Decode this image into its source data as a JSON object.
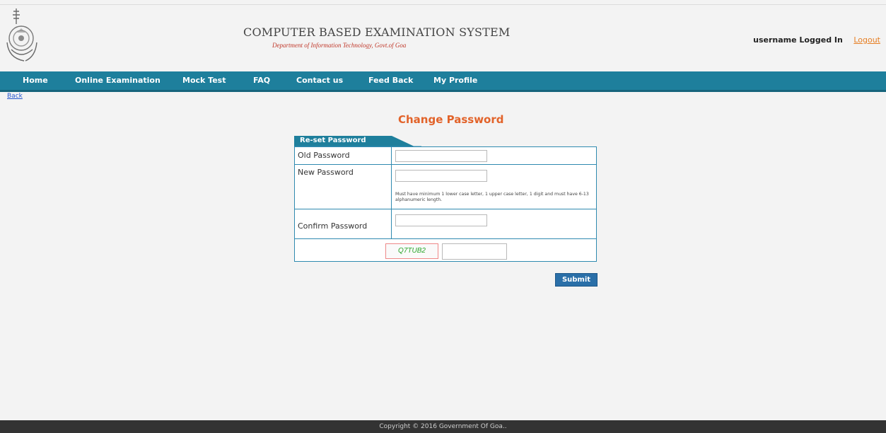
{
  "header": {
    "title": "COMPUTER BASED EXAMINATION SYSTEM",
    "subtitle": "Department of Information Technology, Govt.of Goa",
    "user_status": "username Logged In",
    "logout_label": "Logout",
    "emblem_icon": "state-emblem-icon"
  },
  "nav": {
    "items": [
      {
        "label": "Home"
      },
      {
        "label": "Online Examination"
      },
      {
        "label": "Mock Test"
      },
      {
        "label": "FAQ"
      },
      {
        "label": "Contact us"
      },
      {
        "label": "Feed Back"
      },
      {
        "label": "My Profile"
      }
    ]
  },
  "back_label": "Back",
  "form": {
    "title": "Change Password",
    "tab_label": "Re-set Password",
    "old_password_label": "Old Password",
    "new_password_label": "New Password",
    "password_hint": "Must have minimum 1 lower case letter, 1 upper case letter, 1 digit and must have 6-13 alphanumeric length.",
    "confirm_password_label": "Confirm Password",
    "captcha_text": "Q7TUB2",
    "submit_label": "Submit"
  },
  "footer": {
    "copyright": "Copyright © 2016 Government Of Goa.."
  },
  "colors": {
    "nav_bg": "#1e7f9c",
    "title_accent": "#e2632a",
    "logout": "#e67e22",
    "footer_bg": "#333333"
  }
}
